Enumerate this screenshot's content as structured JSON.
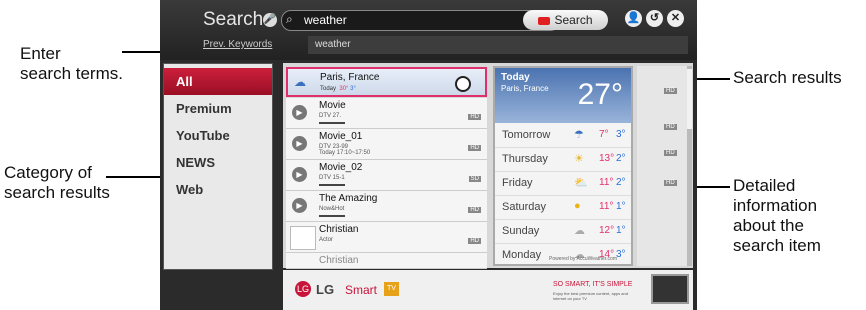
{
  "callouts": {
    "enter_line1": "Enter",
    "enter_line2": "search terms.",
    "category_line1": "Category of",
    "category_line2": "search results",
    "results": "Search results",
    "detail_line1": "Detailed",
    "detail_line2": "information",
    "detail_line3": "about the",
    "detail_line4": "search item"
  },
  "header": {
    "title": "Search",
    "search_value": "weather",
    "search_button": "Search",
    "prev_keywords": "Prev. Keywords",
    "prev_keyword_item": "weather"
  },
  "categories": [
    "All",
    "Premium",
    "YouTube",
    "NEWS",
    "Web"
  ],
  "results": {
    "paris": {
      "title": "Paris, France",
      "day": "Today",
      "hi": "30°",
      "lo": "3°"
    },
    "items": [
      {
        "title": "Movie",
        "sub": "DTV 27.",
        "badge": "HD"
      },
      {
        "title": "Movie_01",
        "sub": "DTV 23-99\nToday 17:10~17:50",
        "badge": "HD"
      },
      {
        "title": "Movie_02",
        "sub": "DTV 15-1",
        "badge": "SD"
      },
      {
        "title": "The Amazing",
        "sub": "Now&Hot",
        "badge": "HD"
      },
      {
        "title": "Christian",
        "sub": "Actor",
        "badge": "HD"
      },
      {
        "title": "Christian",
        "sub": "",
        "badge": ""
      }
    ],
    "far_badges": [
      "HD",
      "HD",
      "HD",
      "HD"
    ]
  },
  "weather": {
    "day": "Today",
    "city": "Paris, France",
    "temp": "27°",
    "forecast": [
      {
        "day": "Tomorrow",
        "hi": "7°",
        "lo": "3°"
      },
      {
        "day": "Thursday",
        "hi": "13°",
        "lo": "2°"
      },
      {
        "day": "Friday",
        "hi": "11°",
        "lo": "2°"
      },
      {
        "day": "Saturday",
        "hi": "11°",
        "lo": "1°"
      },
      {
        "day": "Sunday",
        "hi": "12°",
        "lo": "1°"
      },
      {
        "day": "Monday",
        "hi": "14°",
        "lo": "3°"
      }
    ],
    "powered": "Powered by AccuWeather.com"
  },
  "banner": {
    "lg": "LG",
    "smart": "Smart",
    "tv": "TV",
    "slogan": "SO SMART, IT'S SIMPLE",
    "sub": "Enjoy the best premium content, apps and internet on your TV"
  },
  "colors": {
    "accent": "#c9143a",
    "highlight": "#e0306c",
    "cold": "#2a6fd6"
  }
}
